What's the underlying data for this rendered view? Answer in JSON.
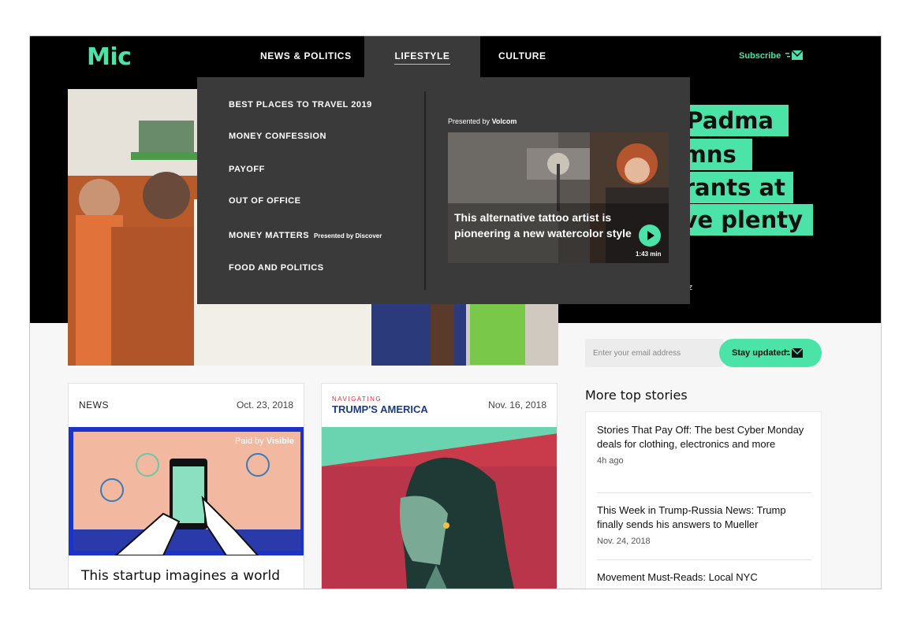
{
  "header": {
    "logo": "Mic",
    "nav": [
      "NEWS & POLITICS",
      "LIFESTYLE",
      "CULTURE"
    ],
    "subscribe": "Subscribe"
  },
  "dropdown": {
    "items": [
      "BEST PLACES TO TRAVEL 2019",
      "MONEY CONFESSION",
      "PAYOFF",
      "OUT OF OFFICE",
      "MONEY MATTERS",
      "FOOD AND POLITICS"
    ],
    "money_matters_sub_prefix": "Presented by",
    "money_matters_sub_brand": "Discover",
    "presented_prefix": "Presented by",
    "presented_brand": "Volcom",
    "video_title": "This alternative tattoo artist is pioneering a new watercolor style",
    "video_duration": "1:43 min"
  },
  "hero": {
    "headline_lines": [
      "r Padma",
      "emns",
      "grants at",
      "ave plenty"
    ],
    "byline": "rtz"
  },
  "signup": {
    "placeholder": "Enter your email address",
    "button": "Stay updated"
  },
  "more": {
    "title": "More top stories",
    "stories": [
      {
        "title": "Stories That Pay Off: The best Cyber Monday deals for clothing, electronics and more",
        "time": "4h ago"
      },
      {
        "title": "This Week in Trump-Russia News: Trump finally sends his answers to Mueller",
        "time": "Nov. 24, 2018"
      },
      {
        "title": "Movement Must-Reads: Local NYC",
        "time": ""
      }
    ]
  },
  "cards": {
    "news": {
      "label": "NEWS",
      "date": "Oct. 23, 2018",
      "paid_prefix": "Paid by",
      "paid_brand": "Visible",
      "title": "This startup imagines a world"
    },
    "trump": {
      "label_small": "NAVIGATING",
      "label_big": "TRUMP'S AMERICA",
      "date": "Nov. 16, 2018"
    }
  },
  "colors": {
    "accent": "#4ce3a8",
    "dropdown_bg": "#3a3a3a",
    "header_bg": "#000000"
  }
}
